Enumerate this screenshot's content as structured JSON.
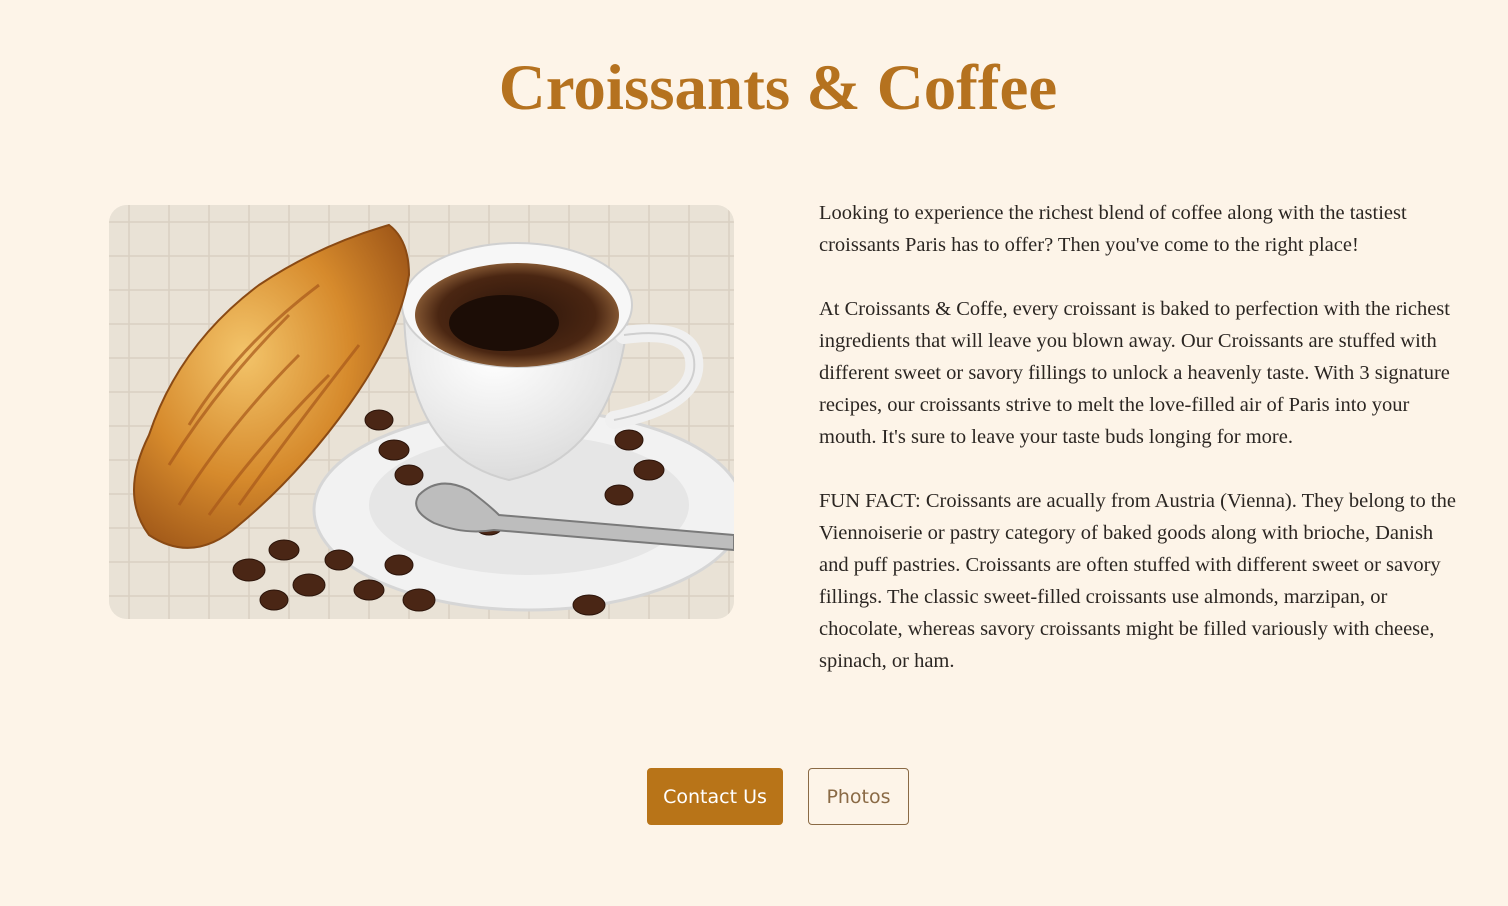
{
  "page": {
    "title": "Croissants & Coffee"
  },
  "hero": {
    "image_description_icon": "croissant-coffee-photo"
  },
  "content": {
    "paragraphs": [
      "Looking to experience the richest blend of coffee along with the tastiest croissants Paris has to offer? Then you've come to the right place!",
      "At Croissants & Coffe, every croissant is baked to perfection with the richest ingredients that will leave you blown away. Our Croissants are stuffed with different sweet or savory fillings to unlock a heavenly taste. With 3 signature recipes, our croissants strive to melt the love-filled air of Paris into your mouth. It's sure to leave your taste buds longing for more.",
      "FUN FACT: Croissants are acually from Austria (Vienna). They belong to the Viennoiserie or pastry category of baked goods along with brioche, Danish and puff pastries. Croissants are often stuffed with different sweet or savory fillings. The classic sweet-filled croissants use almonds, marzipan, or chocolate, whereas savory croissants might be filled variously with cheese, spinach, or ham."
    ]
  },
  "actions": {
    "contact_label": "Contact Us",
    "photos_label": "Photos"
  },
  "colors": {
    "background": "#fdf4e8",
    "accent": "#b5721f",
    "button_primary": "#b87418",
    "button_outline": "#8a6a45"
  }
}
